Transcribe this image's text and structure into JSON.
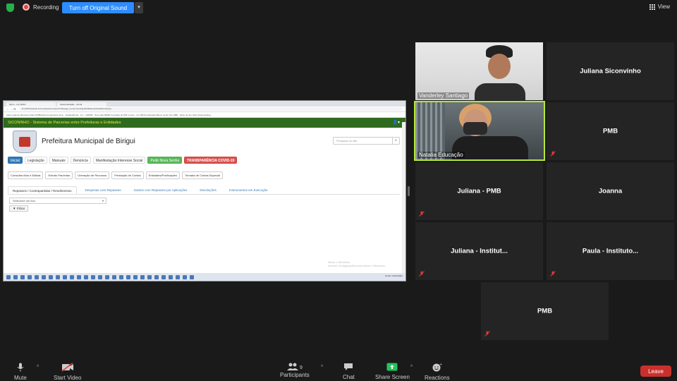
{
  "topbar": {
    "recording_label": "Recording",
    "original_sound_button": "Turn off Original Sound",
    "view_label": "View"
  },
  "shared_screen": {
    "browser_tabs": [
      "Sicon - Lei 13019",
      "Sistematização - Jornal"
    ],
    "address": "fvm1907/licitante.br/municipiosmun/poc/?Ultraoge_nome=municipal%3Dfamasidvd&20ordrigUp...",
    "bookmarks": "Apps   Lojas do Mercado   Vídeo Diti/Barista   Componente de E...   Graduat/Imob.. 2-1...   GDWW - Sem etbo   RENE   Consultar de PDF   Lonvio - Lei 13019   Instituição   Banco Cento Sco   HBR - Fazer de Sm   https://www.lesbuig...",
    "site_header": "SICON∕NHO - Sistema de Parcerias entre Prefeituras e Entidades",
    "site_title": "Prefeitura Municipal de Birigui",
    "search_placeholder": "Pesquisa no site",
    "nav": [
      "Inicial",
      "Legislação",
      "Manuais",
      "Denúncia",
      "Manifestação Interesse Social",
      "Pedir Nova Senha",
      "TRANSPARÊNCIA COVID-19"
    ],
    "subnav": [
      "Consultar Atos e Editais",
      "Extrato Parcerias",
      "Liberação de Recursos",
      "Prestação de Contas",
      "Entidades/Publicações",
      "Tomada de Contas Especial"
    ],
    "tabs": [
      "Repasses / Contrapartidas / Rendimentos",
      "Despesas com Repasses",
      "Gastos com Repasses por Aplicações",
      "Devoluções",
      "Instrumentos em Execução"
    ],
    "year_select": "Selecione um Ano",
    "filter_button": "Filtrar",
    "activate_windows": "Ativar o Windows",
    "activate_windows_sub": "Acesse Configurações para ativar o Windows.",
    "clock": "12:00 / 13/07/2021"
  },
  "participants": [
    {
      "name": "Vanderley Santiago",
      "video": true,
      "muted": false
    },
    {
      "name": "Juliana Siconvinho",
      "video": false,
      "muted": false
    },
    {
      "name": "Natalia Educação",
      "video": true,
      "muted": false
    },
    {
      "name": "PMB",
      "video": false,
      "muted": true
    },
    {
      "name": "Juliana - PMB",
      "video": false,
      "muted": true
    },
    {
      "name": "Joanna",
      "video": false,
      "muted": false
    },
    {
      "name": "Juliana - Institut...",
      "video": false,
      "muted": true
    },
    {
      "name": "Paula - Instituto...",
      "video": false,
      "muted": true
    },
    {
      "name": "PMB",
      "video": false,
      "muted": true
    }
  ],
  "bottombar": {
    "mute": "Mute",
    "start_video": "Start Video",
    "participants": "Participants",
    "participants_count": "9",
    "chat": "Chat",
    "share_screen": "Share Screen",
    "reactions": "Reactions",
    "leave": "Leave"
  },
  "colors": {
    "zoom_blue": "#2d8cff",
    "active_speaker": "#b5e63b",
    "leave_red": "#c9302c",
    "share_green": "#21c45a"
  }
}
